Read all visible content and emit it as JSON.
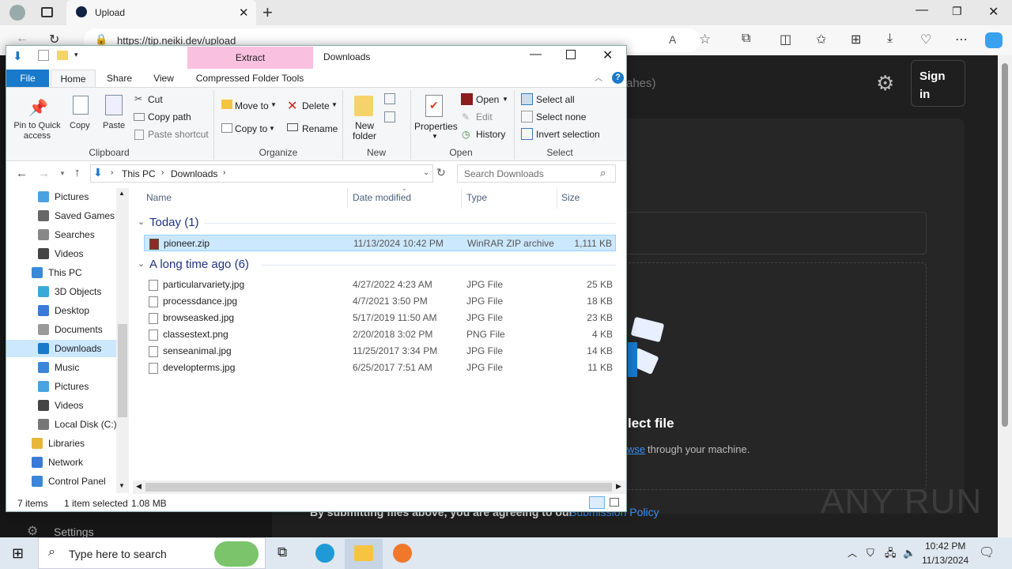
{
  "browser": {
    "tab_title": "Upload",
    "url": "https://tip.neiki.dev/upload",
    "new_tab_symbol": "+"
  },
  "webpage": {
    "search_partial": "ahes)",
    "sign_in": "Sign in",
    "select_file_partial": "lect file",
    "browse_link_partial": "wse",
    "browse_rest": "through your machine.",
    "policy_text": "By submitting files above, you are agreeing to our",
    "policy_link": "Submission Policy",
    "sidebar_settings": "Settings",
    "watermark": "ANY RUN"
  },
  "explorer": {
    "title": "Downloads",
    "context_tab": "Extract",
    "context_sub": "Compressed Folder Tools",
    "ribbon_tabs": [
      "File",
      "Home",
      "Share",
      "View"
    ],
    "clipboard": {
      "pin": "Pin to Quick access",
      "copy": "Copy",
      "paste": "Paste",
      "cut": "Cut",
      "copy_path": "Copy path",
      "paste_shortcut": "Paste shortcut",
      "group": "Clipboard"
    },
    "organize": {
      "move_to": "Move to",
      "copy_to": "Copy to",
      "delete": "Delete",
      "rename": "Rename",
      "group": "Organize"
    },
    "new": {
      "new_folder": "New folder",
      "group": "New"
    },
    "open": {
      "properties": "Properties",
      "open": "Open",
      "edit": "Edit",
      "history": "History",
      "group": "Open"
    },
    "select": {
      "select_all": "Select all",
      "select_none": "Select none",
      "invert": "Invert selection",
      "group": "Select"
    },
    "breadcrumb": [
      "This PC",
      "Downloads"
    ],
    "search_placeholder": "Search Downloads",
    "nav": [
      {
        "label": "Pictures",
        "icon": "pictures-icon"
      },
      {
        "label": "Saved Games",
        "icon": "saved-games-icon"
      },
      {
        "label": "Searches",
        "icon": "searches-icon"
      },
      {
        "label": "Videos",
        "icon": "videos-icon"
      },
      {
        "label": "This PC",
        "icon": "this-pc-icon"
      },
      {
        "label": "3D Objects",
        "icon": "3d-objects-icon"
      },
      {
        "label": "Desktop",
        "icon": "desktop-icon"
      },
      {
        "label": "Documents",
        "icon": "documents-icon"
      },
      {
        "label": "Downloads",
        "icon": "downloads-icon"
      },
      {
        "label": "Music",
        "icon": "music-icon"
      },
      {
        "label": "Pictures",
        "icon": "pictures-icon"
      },
      {
        "label": "Videos",
        "icon": "videos-icon"
      },
      {
        "label": "Local Disk (C:)",
        "icon": "drive-icon"
      },
      {
        "label": "Libraries",
        "icon": "libraries-icon"
      },
      {
        "label": "Network",
        "icon": "network-icon"
      },
      {
        "label": "Control Panel",
        "icon": "control-panel-icon"
      }
    ],
    "columns": [
      "Name",
      "Date modified",
      "Type",
      "Size"
    ],
    "groups": [
      {
        "label": "Today (1)",
        "files": [
          {
            "name": "pioneer.zip",
            "date": "11/13/2024 10:42 PM",
            "type": "WinRAR ZIP archive",
            "size": "1,111 KB"
          }
        ]
      },
      {
        "label": "A long time ago (6)",
        "files": [
          {
            "name": "particularvariety.jpg",
            "date": "4/27/2022 4:23 AM",
            "type": "JPG File",
            "size": "25 KB"
          },
          {
            "name": "processdance.jpg",
            "date": "4/7/2021 3:50 PM",
            "type": "JPG File",
            "size": "18 KB"
          },
          {
            "name": "browseasked.jpg",
            "date": "5/17/2019 11:50 AM",
            "type": "JPG File",
            "size": "23 KB"
          },
          {
            "name": "classestext.png",
            "date": "2/20/2018 3:02 PM",
            "type": "PNG File",
            "size": "4 KB"
          },
          {
            "name": "senseanimal.jpg",
            "date": "11/25/2017 3:34 PM",
            "type": "JPG File",
            "size": "14 KB"
          },
          {
            "name": "developterms.jpg",
            "date": "6/25/2017 7:51 AM",
            "type": "JPG File",
            "size": "11 KB"
          }
        ]
      }
    ],
    "status": {
      "items": "7 items",
      "selected": "1 item selected",
      "size": "1.08 MB"
    }
  },
  "taskbar": {
    "search_placeholder": "Type here to search",
    "time": "10:42 PM",
    "date": "11/13/2024"
  },
  "colors": {
    "selection": "#cce8ff",
    "accent": "#1979ca",
    "context_tab": "#f9c0e0"
  }
}
